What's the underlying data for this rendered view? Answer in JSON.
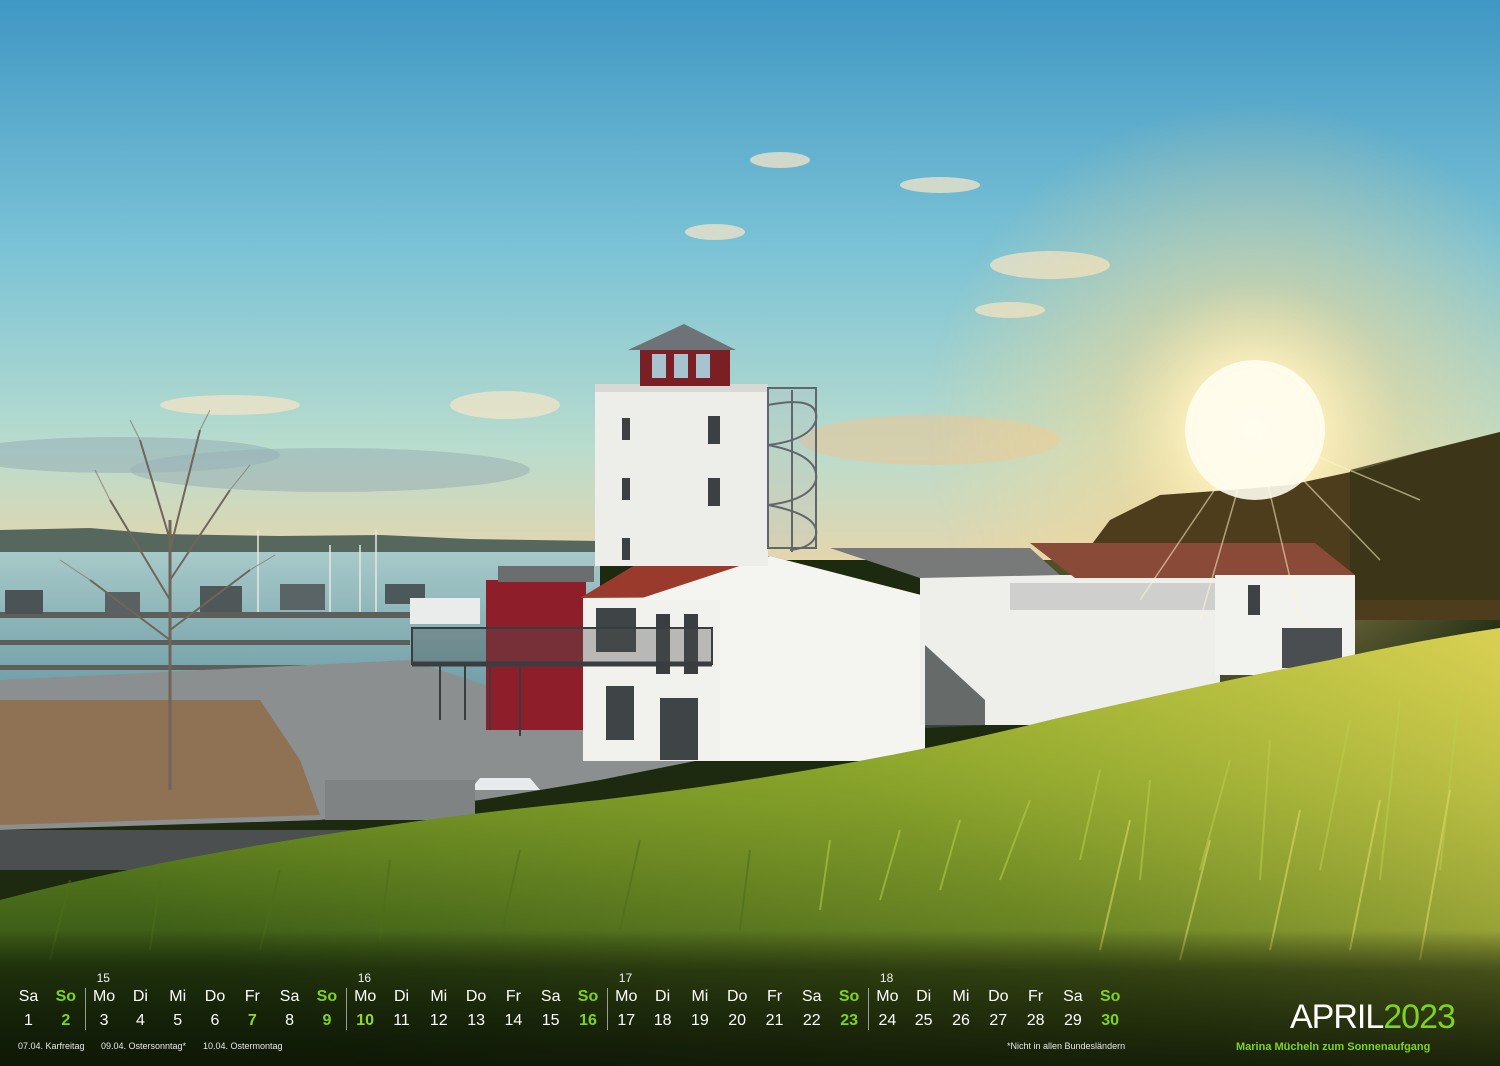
{
  "month": "APRIL",
  "year": "2023",
  "subtitle": "Marina Mücheln zum Sonnenaufgang",
  "week_numbers": [
    "15",
    "16",
    "17",
    "18"
  ],
  "days": [
    {
      "wd": "Sa",
      "d": "1"
    },
    {
      "wd": "So",
      "d": "2"
    },
    {
      "wd": "Mo",
      "d": "3"
    },
    {
      "wd": "Di",
      "d": "4"
    },
    {
      "wd": "Mi",
      "d": "5"
    },
    {
      "wd": "Do",
      "d": "6"
    },
    {
      "wd": "Fr",
      "d": "7"
    },
    {
      "wd": "Sa",
      "d": "8"
    },
    {
      "wd": "So",
      "d": "9"
    },
    {
      "wd": "Mo",
      "d": "10"
    },
    {
      "wd": "Di",
      "d": "11"
    },
    {
      "wd": "Mi",
      "d": "12"
    },
    {
      "wd": "Do",
      "d": "13"
    },
    {
      "wd": "Fr",
      "d": "14"
    },
    {
      "wd": "Sa",
      "d": "15"
    },
    {
      "wd": "So",
      "d": "16"
    },
    {
      "wd": "Mo",
      "d": "17"
    },
    {
      "wd": "Di",
      "d": "18"
    },
    {
      "wd": "Mi",
      "d": "19"
    },
    {
      "wd": "Do",
      "d": "20"
    },
    {
      "wd": "Fr",
      "d": "21"
    },
    {
      "wd": "Sa",
      "d": "22"
    },
    {
      "wd": "So",
      "d": "23"
    },
    {
      "wd": "Mo",
      "d": "24"
    },
    {
      "wd": "Di",
      "d": "25"
    },
    {
      "wd": "Mi",
      "d": "26"
    },
    {
      "wd": "Do",
      "d": "27"
    },
    {
      "wd": "Fr",
      "d": "28"
    },
    {
      "wd": "Sa",
      "d": "29"
    },
    {
      "wd": "So",
      "d": "30"
    }
  ],
  "holidays": {
    "h1": "07.04. Karfreitag",
    "h2": "09.04. Ostersonntag*",
    "h3": "10.04. Ostermontag"
  },
  "footnote": "*Nicht in allen Bundesländern",
  "colors": {
    "accent_green": "#7ed321",
    "tower_red": "#8e1f2a"
  }
}
